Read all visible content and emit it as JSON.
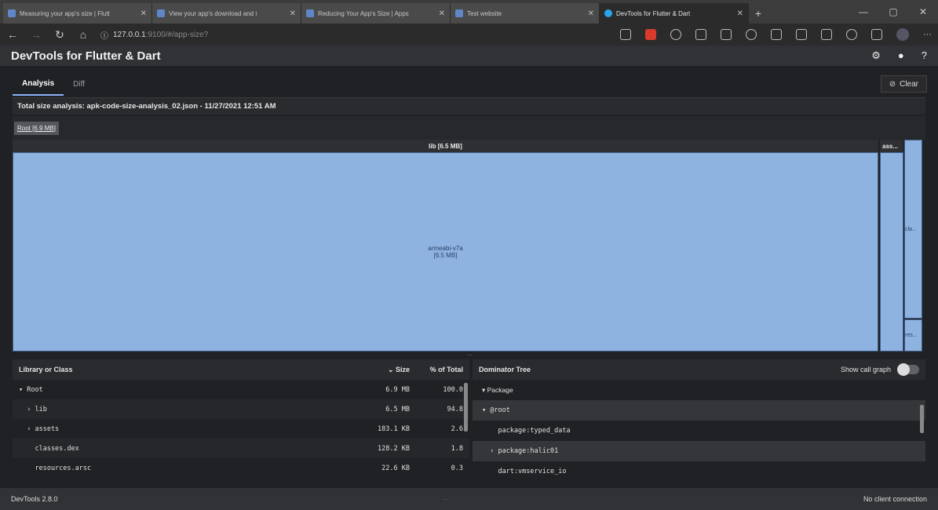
{
  "browser": {
    "tabs": [
      {
        "title": "Measuring your app's size | Flutt",
        "active": false
      },
      {
        "title": "View your app's download and i",
        "active": false
      },
      {
        "title": "Reducing Your App's Size | Apps",
        "active": false
      },
      {
        "title": "Test website",
        "active": false
      },
      {
        "title": "DevTools for Flutter & Dart",
        "active": true
      }
    ],
    "url_host": "127.0.0.1",
    "url_rest": ":9100/#/app-size?"
  },
  "app": {
    "title": "DevTools for Flutter & Dart"
  },
  "subtabs": {
    "analysis": "Analysis",
    "diff": "Diff"
  },
  "clear_label": "Clear",
  "info": "Total size analysis: apk-code-size-analysis_02.json - 11/27/2021 12:51 AM",
  "breadcrumb": "Root [6.9 MB]",
  "treemap": {
    "lib_header": "lib [6.5 MB]",
    "assets_header": "ass...",
    "main_name": "armeabi-v7a",
    "main_size": "[6.5 MB]",
    "small1": "cla...",
    "small2": "res..."
  },
  "table": {
    "headers": {
      "name": "Library or Class",
      "size": "Size",
      "pct": "% of Total"
    },
    "rows": [
      {
        "name": "▾ Root",
        "size": "6.9 MB",
        "pct": "100.0"
      },
      {
        "name": "  › lib",
        "size": "6.5 MB",
        "pct": "94.8"
      },
      {
        "name": "  › assets",
        "size": "183.1 KB",
        "pct": "2.6"
      },
      {
        "name": "    classes.dex",
        "size": "128.2 KB",
        "pct": "1.8"
      },
      {
        "name": "    resources.arsc",
        "size": "22.6 KB",
        "pct": "0.3"
      }
    ]
  },
  "dominator": {
    "title": "Dominator Tree",
    "toggle_label": "Show call graph",
    "rows": [
      {
        "label": "▾ Package",
        "mono": false
      },
      {
        "label": "▾ @root",
        "mono": true
      },
      {
        "label": "    package:typed_data",
        "mono": true
      },
      {
        "label": "  › package:halic01",
        "mono": true
      },
      {
        "label": "    dart:vmservice_io",
        "mono": true
      }
    ]
  },
  "status": {
    "left": "DevTools 2.8.0",
    "right": "No client connection"
  }
}
